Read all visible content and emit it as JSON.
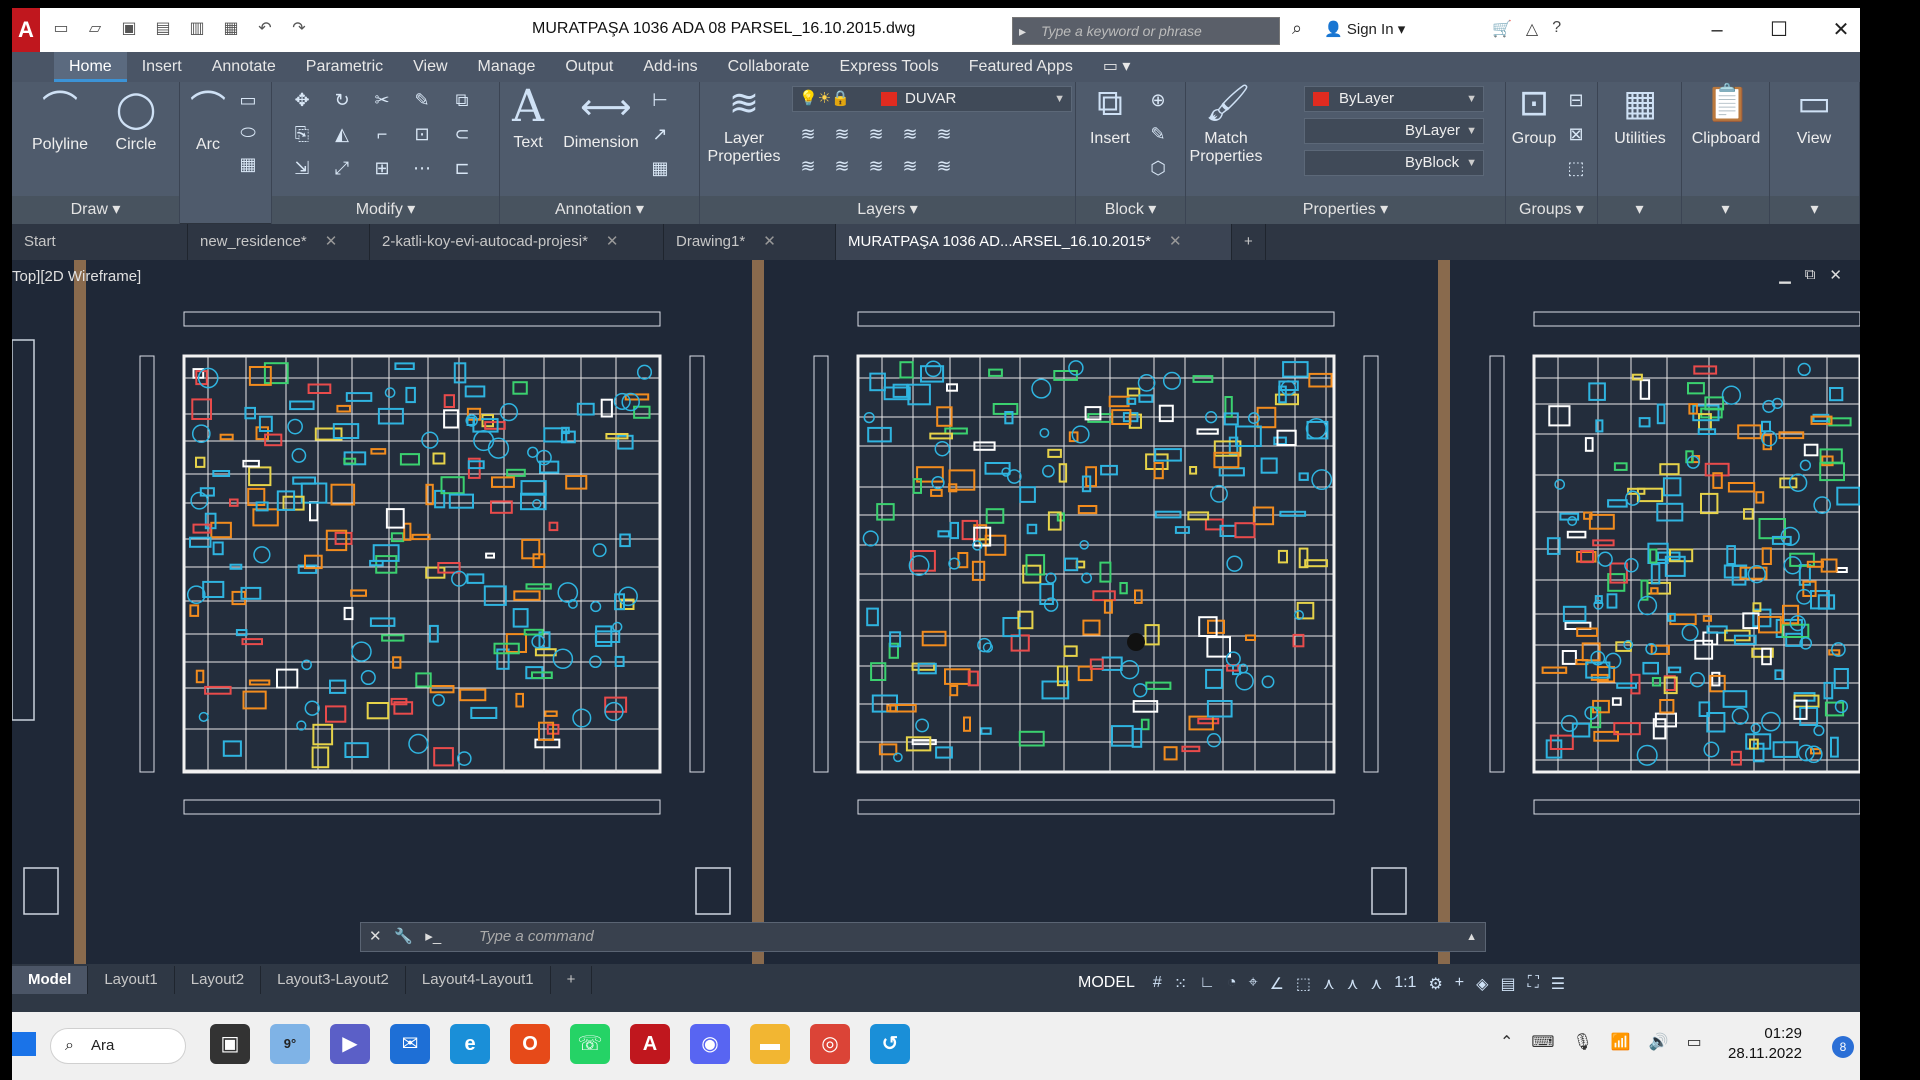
{
  "window": {
    "title": "MURATPAŞA 1036 ADA 08 PARSEL_16.10.2015.dwg",
    "search_placeholder": "Type a keyword or phrase",
    "sign_in": "Sign In"
  },
  "ribbon_tabs": [
    "Home",
    "Insert",
    "Annotate",
    "Parametric",
    "View",
    "Manage",
    "Output",
    "Add-ins",
    "Collaborate",
    "Express Tools",
    "Featured Apps"
  ],
  "ribbon": {
    "draw": {
      "title": "Draw",
      "polyline": "Polyline",
      "circle": "Circle",
      "arc": "Arc"
    },
    "modify": {
      "title": "Modify"
    },
    "annotation": {
      "title": "Annotation",
      "text": "Text",
      "dimension": "Dimension"
    },
    "layers": {
      "title": "Layers",
      "layer_properties": "Layer Properties",
      "current_layer": "DUVAR"
    },
    "block": {
      "title": "Block",
      "insert": "Insert"
    },
    "properties": {
      "title": "Properties",
      "match_properties": "Match Properties",
      "color": "ByLayer",
      "linetype": "ByLayer",
      "lineweight": "ByBlock"
    },
    "groups": {
      "title": "Groups",
      "group": "Group"
    },
    "utilities": "Utilities",
    "clipboard": "Clipboard",
    "view": "View"
  },
  "doc_tabs": [
    "Start",
    "new_residence*",
    "2-katli-koy-evi-autocad-projesi*",
    "Drawing1*",
    "MURATPAŞA 1036 AD...ARSEL_16.10.2015*"
  ],
  "viewport_label": "Top][2D Wireframe]",
  "command_placeholder": "Type a command",
  "layout_tabs": [
    "Model",
    "Layout1",
    "Layout2",
    "Layout3-Layout2",
    "Layout4-Layout1"
  ],
  "status": {
    "model": "MODEL",
    "scale": "1:1"
  },
  "taskbar": {
    "search": "Ara",
    "time": "01:29",
    "date": "28.11.2022",
    "weather": "9°",
    "notifications": "8"
  },
  "colors": {
    "layer_swatch": "#e02b20",
    "accent": "#3c93d6",
    "canvas": "#1f2837"
  }
}
